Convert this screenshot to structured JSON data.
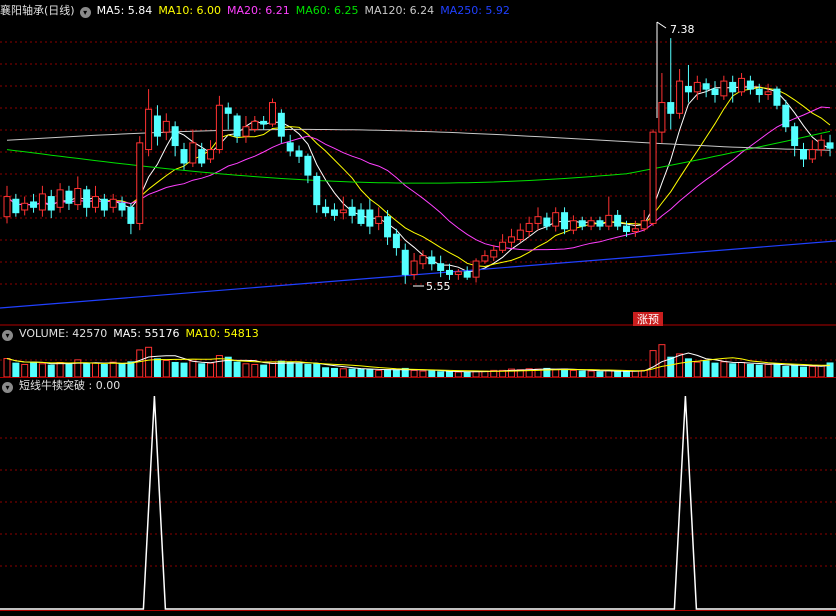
{
  "header": {
    "stock_name": "襄阳轴承(日线)",
    "ma_items": [
      {
        "text": "MA5: 5.84",
        "color": "#ffffff"
      },
      {
        "text": "MA10: 6.00",
        "color": "#ffff00"
      },
      {
        "text": "MA20: 6.21",
        "color": "#ff40ff"
      },
      {
        "text": "MA60: 6.25",
        "color": "#00e000"
      },
      {
        "text": "MA120: 6.24",
        "color": "#c8c8c8"
      },
      {
        "text": "MA250: 5.92",
        "color": "#2040ff"
      }
    ]
  },
  "volume_header": {
    "label": "VOLUME: 42570",
    "ma5": "MA5: 55176",
    "ma10": "MA10: 54813"
  },
  "indicator_header": {
    "label": "短线牛犊突破 : 0.00"
  },
  "annotations": {
    "high": "7.38",
    "low": "5.55",
    "tag": "涨预"
  },
  "colors": {
    "up": "#ff3232",
    "down": "#54ffff",
    "grid": "#8b0000",
    "signal": "#ffffff",
    "tag_bg": "#c81e1e"
  },
  "chart_data": [
    {
      "type": "candlestick",
      "ylim": [
        5.4,
        7.5
      ],
      "high_label": 7.38,
      "low_label": 5.55,
      "candles": [
        [
          6.05,
          6.2,
          6.0,
          6.28
        ],
        [
          6.18,
          6.08,
          6.05,
          6.22
        ],
        [
          6.1,
          6.15,
          6.06,
          6.2
        ],
        [
          6.16,
          6.12,
          6.08,
          6.22
        ],
        [
          6.1,
          6.22,
          6.05,
          6.28
        ],
        [
          6.2,
          6.1,
          6.04,
          6.25
        ],
        [
          6.12,
          6.25,
          6.08,
          6.3
        ],
        [
          6.24,
          6.15,
          6.1,
          6.28
        ],
        [
          6.14,
          6.26,
          6.1,
          6.35
        ],
        [
          6.25,
          6.12,
          6.05,
          6.28
        ],
        [
          6.12,
          6.2,
          6.08,
          6.28
        ],
        [
          6.18,
          6.1,
          6.05,
          6.22
        ],
        [
          6.12,
          6.18,
          6.08,
          6.22
        ],
        [
          6.15,
          6.1,
          6.05,
          6.2
        ],
        [
          6.12,
          6.0,
          5.92,
          6.15
        ],
        [
          6.0,
          6.6,
          5.95,
          6.65
        ],
        [
          6.55,
          6.85,
          6.5,
          7.0
        ],
        [
          6.8,
          6.65,
          6.58,
          6.88
        ],
        [
          6.68,
          6.76,
          6.62,
          6.82
        ],
        [
          6.72,
          6.58,
          6.5,
          6.76
        ],
        [
          6.55,
          6.45,
          6.4,
          6.6
        ],
        [
          6.45,
          6.6,
          6.42,
          6.7
        ],
        [
          6.55,
          6.45,
          6.42,
          6.6
        ],
        [
          6.48,
          6.55,
          6.45,
          6.62
        ],
        [
          6.55,
          6.88,
          6.52,
          6.95
        ],
        [
          6.86,
          6.82,
          6.7,
          6.9
        ],
        [
          6.8,
          6.65,
          6.6,
          6.82
        ],
        [
          6.65,
          6.72,
          6.6,
          6.8
        ],
        [
          6.7,
          6.76,
          6.68,
          6.8
        ],
        [
          6.76,
          6.74,
          6.7,
          6.8
        ],
        [
          6.74,
          6.9,
          6.72,
          6.93
        ],
        [
          6.82,
          6.65,
          6.6,
          6.85
        ],
        [
          6.6,
          6.54,
          6.5,
          6.66
        ],
        [
          6.54,
          6.5,
          6.45,
          6.58
        ],
        [
          6.5,
          6.36,
          6.3,
          6.52
        ],
        [
          6.35,
          6.14,
          6.08,
          6.38
        ],
        [
          6.12,
          6.08,
          6.05,
          6.18
        ],
        [
          6.1,
          6.06,
          6.02,
          6.15
        ],
        [
          6.08,
          6.1,
          6.03,
          6.2
        ],
        [
          6.12,
          6.06,
          6.0,
          6.18
        ],
        [
          6.1,
          6.0,
          5.98,
          6.15
        ],
        [
          6.1,
          5.98,
          5.92,
          6.18
        ],
        [
          6.0,
          6.05,
          5.95,
          6.12
        ],
        [
          6.05,
          5.9,
          5.84,
          6.1
        ],
        [
          5.92,
          5.82,
          5.76,
          5.96
        ],
        [
          5.8,
          5.62,
          5.55,
          5.85
        ],
        [
          5.62,
          5.72,
          5.58,
          5.78
        ],
        [
          5.7,
          5.76,
          5.66,
          5.8
        ],
        [
          5.75,
          5.7,
          5.65,
          5.8
        ],
        [
          5.7,
          5.65,
          5.6,
          5.76
        ],
        [
          5.65,
          5.62,
          5.58,
          5.7
        ],
        [
          5.62,
          5.64,
          5.58,
          5.66
        ],
        [
          5.64,
          5.6,
          5.58,
          5.68
        ],
        [
          5.6,
          5.72,
          5.56,
          5.74
        ],
        [
          5.72,
          5.76,
          5.7,
          5.8
        ],
        [
          5.75,
          5.8,
          5.72,
          5.84
        ],
        [
          5.8,
          5.86,
          5.78,
          5.92
        ],
        [
          5.86,
          5.9,
          5.82,
          5.96
        ],
        [
          5.88,
          5.95,
          5.86,
          6.0
        ],
        [
          5.94,
          6.0,
          5.9,
          6.05
        ],
        [
          6.0,
          6.05,
          5.95,
          6.12
        ],
        [
          6.04,
          5.98,
          5.95,
          6.08
        ],
        [
          5.98,
          6.08,
          5.94,
          6.12
        ],
        [
          6.08,
          5.96,
          5.92,
          6.12
        ],
        [
          5.95,
          6.02,
          5.92,
          6.06
        ],
        [
          6.02,
          5.98,
          5.95,
          6.05
        ],
        [
          5.98,
          6.02,
          5.95,
          6.05
        ],
        [
          6.02,
          5.98,
          5.95,
          6.05
        ],
        [
          5.98,
          6.06,
          5.95,
          6.2
        ],
        [
          6.06,
          5.98,
          5.95,
          6.1
        ],
        [
          5.98,
          5.94,
          5.9,
          6.02
        ],
        [
          5.94,
          5.96,
          5.9,
          6.02
        ],
        [
          5.96,
          6.02,
          5.94,
          6.1
        ],
        [
          6.0,
          6.68,
          5.98,
          6.7
        ],
        [
          6.68,
          6.9,
          6.6,
          7.12
        ],
        [
          6.9,
          6.82,
          6.7,
          7.38
        ],
        [
          6.82,
          7.06,
          6.78,
          7.15
        ],
        [
          7.02,
          6.98,
          6.9,
          7.18
        ],
        [
          6.98,
          7.05,
          6.92,
          7.1
        ],
        [
          7.04,
          7.0,
          6.94,
          7.08
        ],
        [
          7.0,
          6.96,
          6.9,
          7.06
        ],
        [
          6.95,
          7.06,
          6.92,
          7.1
        ],
        [
          7.05,
          6.98,
          6.9,
          7.1
        ],
        [
          6.98,
          7.08,
          6.95,
          7.12
        ],
        [
          7.06,
          7.0,
          6.96,
          7.1
        ],
        [
          7.0,
          6.96,
          6.9,
          7.04
        ],
        [
          6.96,
          6.98,
          6.92,
          7.04
        ],
        [
          7.0,
          6.88,
          6.85,
          7.02
        ],
        [
          6.88,
          6.72,
          6.68,
          6.92
        ],
        [
          6.72,
          6.58,
          6.5,
          6.75
        ],
        [
          6.55,
          6.48,
          6.42,
          6.6
        ],
        [
          6.48,
          6.55,
          6.45,
          6.62
        ],
        [
          6.55,
          6.62,
          6.5,
          6.66
        ],
        [
          6.6,
          6.56,
          6.5,
          6.66
        ]
      ]
    },
    {
      "type": "bar",
      "title": "VOLUME",
      "ylim": [
        0,
        100000
      ],
      "values": [
        56000,
        42000,
        38000,
        45000,
        40000,
        36000,
        44000,
        38000,
        52000,
        40000,
        42000,
        38000,
        45000,
        40000,
        46000,
        82000,
        90000,
        55000,
        50000,
        44000,
        42000,
        48000,
        40000,
        42000,
        65000,
        60000,
        45000,
        40000,
        38000,
        36000,
        45000,
        48000,
        44000,
        40000,
        38000,
        40000,
        28000,
        26000,
        25000,
        24000,
        24000,
        22000,
        20000,
        22000,
        22000,
        26000,
        20000,
        18000,
        18000,
        16000,
        16000,
        15000,
        15000,
        18000,
        18000,
        20000,
        20000,
        24000,
        22000,
        25000,
        24000,
        26000,
        22000,
        24000,
        20000,
        18000,
        18000,
        16000,
        20000,
        18000,
        16000,
        18000,
        20000,
        80000,
        98000,
        60000,
        70000,
        55000,
        45000,
        48000,
        42000,
        46000,
        40000,
        44000,
        38000,
        36000,
        38000,
        40000,
        32000,
        35000,
        30000,
        32000,
        34000,
        42570
      ]
    },
    {
      "type": "line",
      "title": "短线牛犊突破",
      "ylim": [
        0,
        1
      ],
      "signals": [
        17,
        77
      ],
      "value": 0.0
    }
  ]
}
